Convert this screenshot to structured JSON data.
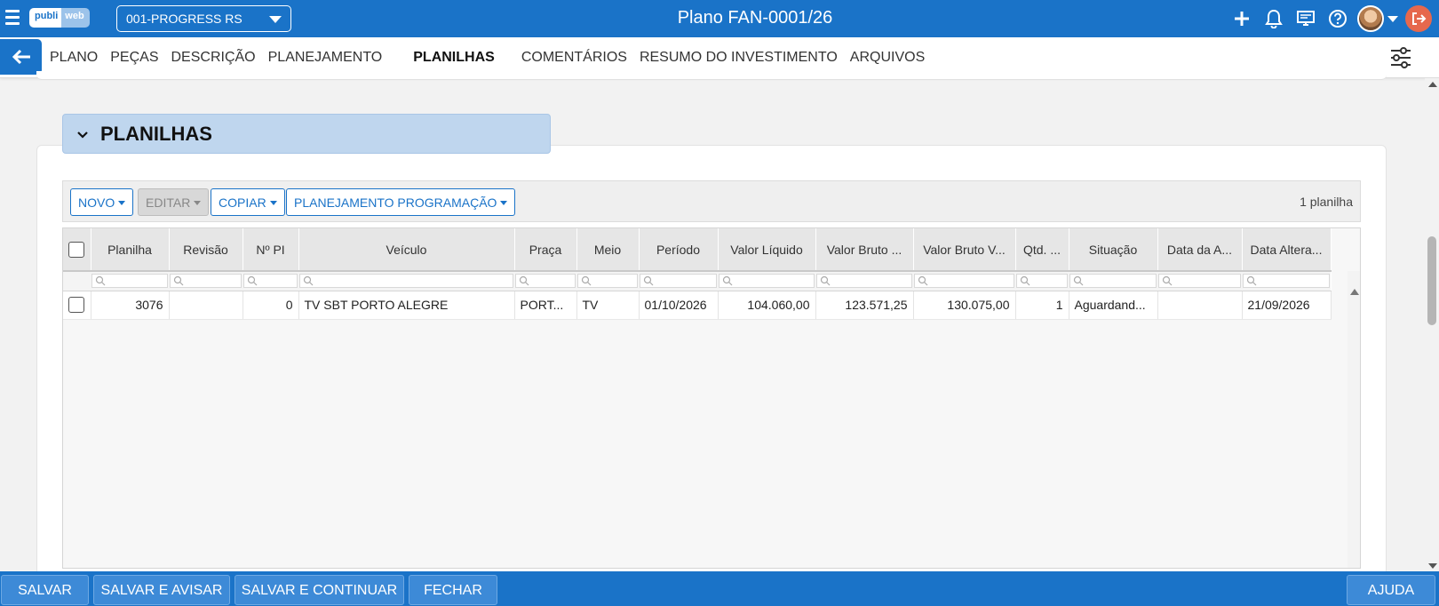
{
  "topbar": {
    "logo_a": "publi",
    "logo_b": "web",
    "client_select_value": "001-PROGRESS RS",
    "title": "Plano FAN-0001/26",
    "icons": [
      "plus-icon",
      "bell-icon",
      "monitor-icon",
      "help-icon",
      "avatar",
      "chevron-down-icon",
      "logout-icon"
    ]
  },
  "tabs": [
    {
      "label": "PLANO",
      "active": false
    },
    {
      "label": "PEÇAS",
      "active": false
    },
    {
      "label": "DESCRIÇÃO",
      "active": false
    },
    {
      "label": "PLANEJAMENTO",
      "active": false
    },
    {
      "label": "PLANILHAS",
      "active": true
    },
    {
      "label": "COMENTÁRIOS",
      "active": false
    },
    {
      "label": "RESUMO DO INVESTIMENTO",
      "active": false
    },
    {
      "label": "ARQUIVOS",
      "active": false
    }
  ],
  "section": {
    "title": "PLANILHAS"
  },
  "toolbar": {
    "novo": "NOVO",
    "editar": "EDITAR",
    "copiar": "COPIAR",
    "planejamento": "PLANEJAMENTO PROGRAMAÇÃO",
    "count": "1 planilha"
  },
  "grid": {
    "columns": [
      "Planilha",
      "Revisão",
      "Nº PI",
      "Veículo",
      "Praça",
      "Meio",
      "Período",
      "Valor Líquido",
      "Valor Bruto ...",
      "Valor Bruto V...",
      "Qtd. ...",
      "Situação",
      "Data da A...",
      "Data Altera..."
    ],
    "rows": [
      {
        "planilha": "3076",
        "revisao": "",
        "n_pi": "0",
        "veiculo": "TV SBT PORTO ALEGRE",
        "praca": "PORT...",
        "meio": "TV",
        "periodo": "01/10/2026",
        "valor_liquido": "104.060,00",
        "valor_bruto": "123.571,25",
        "valor_bruto_v": "130.075,00",
        "qtd": "1",
        "situacao": "Aguardand...",
        "data_a": "",
        "data_alteracao": "21/09/2026"
      }
    ]
  },
  "footer": {
    "salvar": "SALVAR",
    "salvar_avisar": "SALVAR E AVISAR",
    "salvar_continuar": "SALVAR E CONTINUAR",
    "fechar": "FECHAR",
    "ajuda": "AJUDA"
  },
  "colors": {
    "primary": "#1a73c8",
    "section_header": "#bfd6ee"
  }
}
